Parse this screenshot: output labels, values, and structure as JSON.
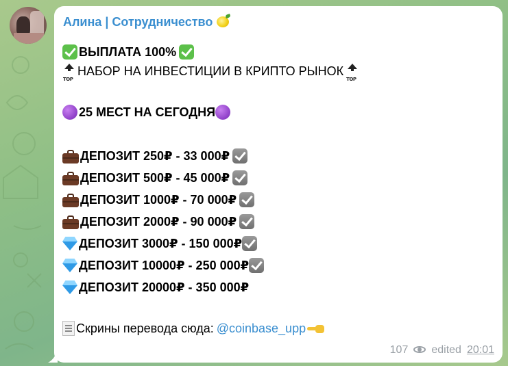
{
  "chat": {
    "sender_name": "Алина | Сотрудничество",
    "sender_emoji": "lemon-emoji",
    "lines": {
      "payout": "ВЫПЛАТА 100%",
      "recruit": "НАБОР НА ИНВЕСТИЦИИ В КРИПТО РЫНОК",
      "places": "25 МЕСТ НА СЕГОДНЯ",
      "deposits": [
        {
          "icon": "briefcase-icon",
          "text": "ДЕПОЗИТ 250₽ - 33 000₽",
          "check": true
        },
        {
          "icon": "briefcase-icon",
          "text": "ДЕПОЗИТ 500₽ - 45 000₽",
          "check": true
        },
        {
          "icon": "briefcase-icon",
          "text": "ДЕПОЗИТ 1000₽ - 70 000₽",
          "check": true
        },
        {
          "icon": "briefcase-icon",
          "text": "ДЕПОЗИТ 2000₽ - 90 000₽",
          "check": true
        },
        {
          "icon": "diamond-icon",
          "text": "ДЕПОЗИТ 3000₽ - 150 000₽",
          "check": true
        },
        {
          "icon": "diamond-icon",
          "text": "ДЕПОЗИТ 10000₽ - 250 000₽",
          "check": true
        },
        {
          "icon": "diamond-icon",
          "text": "ДЕПОЗИТ 20000₽ - 350 000₽",
          "check": false
        }
      ],
      "screenshots_prefix": "Скрины перевода сюда:",
      "screenshots_link": "@coinbase_upp"
    },
    "meta": {
      "views": "107",
      "edited_label": "edited",
      "time": "20:01"
    }
  },
  "colors": {
    "accent": "#3b8fd0",
    "meta_gray": "#9aa0a6",
    "bubble": "#ffffff"
  }
}
